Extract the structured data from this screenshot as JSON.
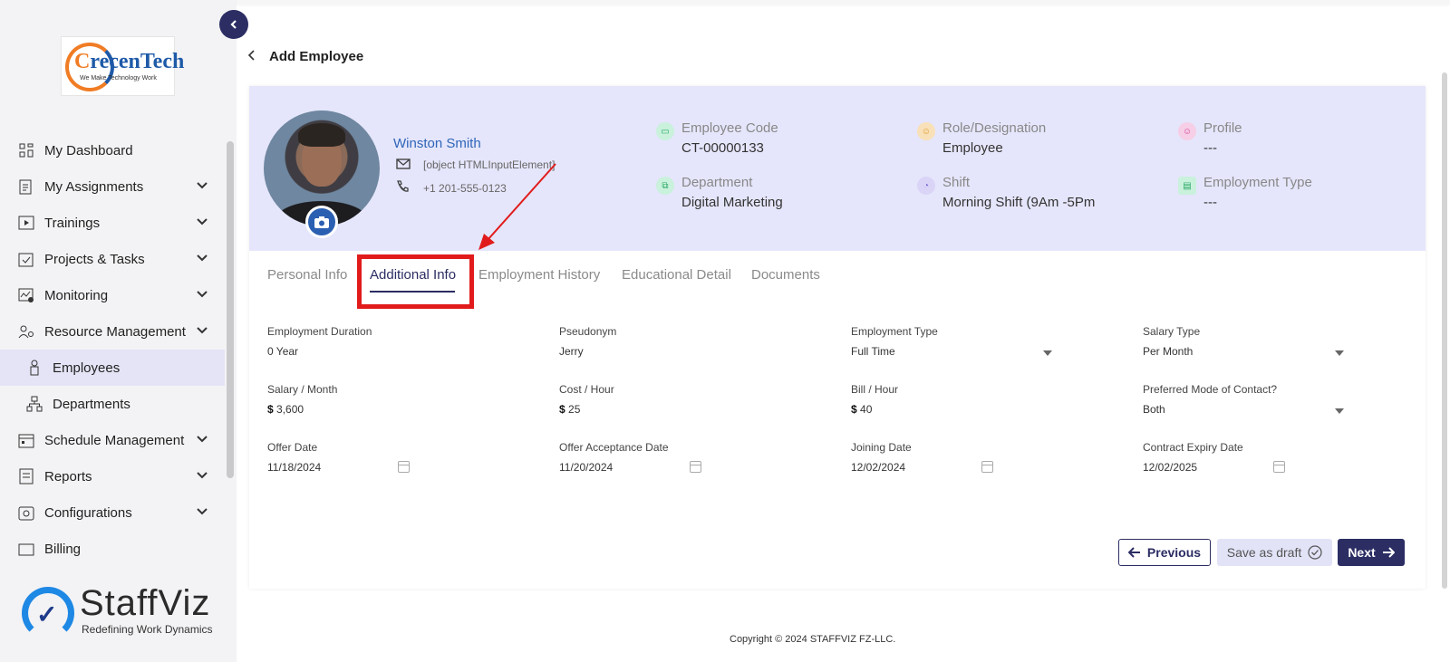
{
  "sidebar": {
    "logo_top": {
      "brand_c": "C",
      "brand_rest": "recenTech",
      "tagline": "We Make Technology Work"
    },
    "items": [
      {
        "label": "My Dashboard",
        "icon": "grid-icon",
        "chevron": false
      },
      {
        "label": "My Assignments",
        "icon": "clipboard-icon",
        "chevron": true
      },
      {
        "label": "Trainings",
        "icon": "play-icon",
        "chevron": true
      },
      {
        "label": "Projects & Tasks",
        "icon": "tasks-icon",
        "chevron": true
      },
      {
        "label": "Monitoring",
        "icon": "monitor-icon",
        "chevron": true
      },
      {
        "label": "Resource Management",
        "icon": "people-gear-icon",
        "chevron": true
      },
      {
        "label": "Employees",
        "icon": "person-icon",
        "sub": true,
        "active": true
      },
      {
        "label": "Departments",
        "icon": "org-icon",
        "sub": true
      },
      {
        "label": "Schedule Management",
        "icon": "calendar-icon",
        "chevron": true
      },
      {
        "label": "Reports",
        "icon": "report-icon",
        "chevron": true
      },
      {
        "label": "Configurations",
        "icon": "config-icon",
        "chevron": true
      },
      {
        "label": "Billing",
        "icon": "billing-icon",
        "chevron": false
      }
    ],
    "logo_bottom": {
      "name": "StaffViz",
      "tagline": "Redefining Work Dynamics"
    }
  },
  "header": {
    "title": "Add Employee"
  },
  "profile": {
    "name": "Winston Smith",
    "email": "[object HTMLInputElement]",
    "phone": "+1 201-555-0123",
    "employee_code_label": "Employee Code",
    "employee_code": "CT-00000133",
    "role_label": "Role/Designation",
    "role": "Employee",
    "profile_label": "Profile",
    "profile": "---",
    "department_label": "Department",
    "department": "Digital Marketing",
    "shift_label": "Shift",
    "shift": "Morning Shift (9Am -5Pm",
    "employment_type_label": "Employment Type",
    "employment_type": "---"
  },
  "tabs": [
    "Personal Info",
    "Additional Info",
    "Employment History",
    "Educational Detail",
    "Documents"
  ],
  "form": {
    "employment_duration": {
      "label": "Employment Duration",
      "value": "0 Year"
    },
    "pseudonym": {
      "label": "Pseudonym",
      "value": "Jerry"
    },
    "employment_type": {
      "label": "Employment Type",
      "value": "Full Time"
    },
    "salary_type": {
      "label": "Salary Type",
      "value": "Per Month"
    },
    "salary_month": {
      "label": "Salary / Month",
      "currency": "$",
      "value": "3,600"
    },
    "cost_hour": {
      "label": "Cost / Hour",
      "currency": "$",
      "value": "25"
    },
    "bill_hour": {
      "label": "Bill / Hour",
      "currency": "$",
      "value": "40"
    },
    "contact_mode": {
      "label": "Preferred Mode of Contact?",
      "value": "Both"
    },
    "offer_date": {
      "label": "Offer Date",
      "value": "11/18/2024"
    },
    "offer_acceptance_date": {
      "label": "Offer Acceptance Date",
      "value": "11/20/2024"
    },
    "joining_date": {
      "label": "Joining Date",
      "value": "12/02/2024"
    },
    "contract_expiry_date": {
      "label": "Contract Expiry Date",
      "value": "12/02/2025"
    }
  },
  "buttons": {
    "previous": "Previous",
    "save_draft": "Save as draft",
    "next": "Next"
  },
  "footer": {
    "copyright": "Copyright © 2024 STAFFVIZ FZ-LLC."
  },
  "colors": {
    "primary": "#2b2d63",
    "banner": "#e5e6fb",
    "highlight": "#e11b1b",
    "link": "#2f65b8"
  }
}
